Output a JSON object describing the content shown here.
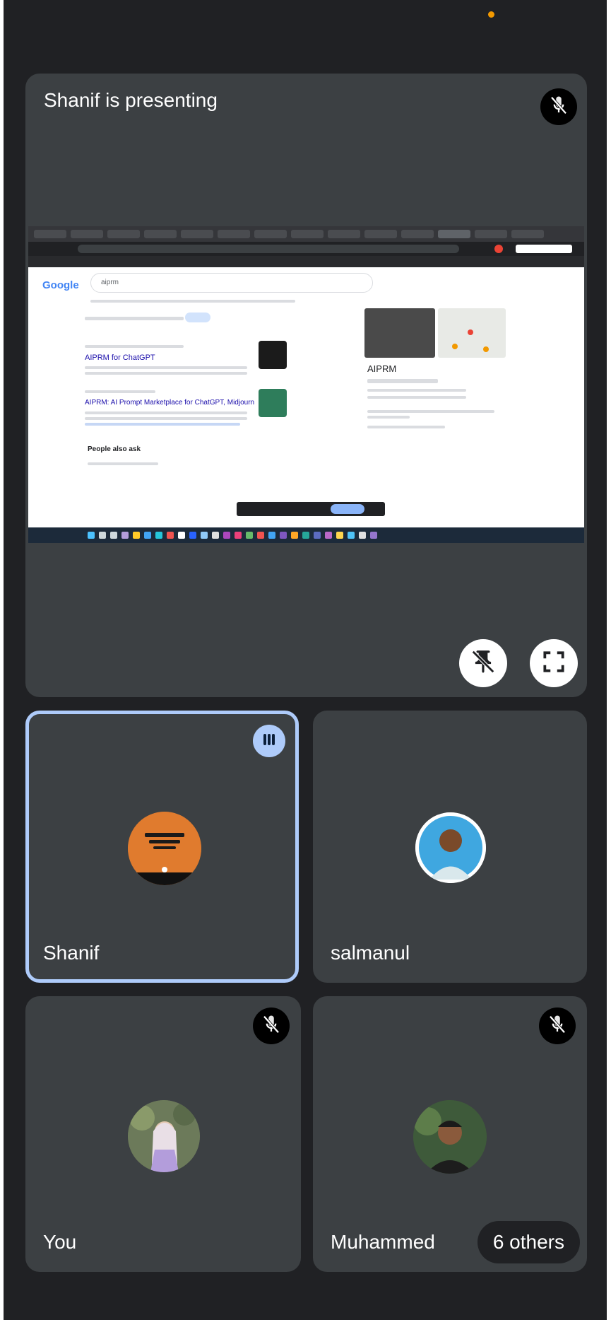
{
  "presentation": {
    "title": "Shanif is presenting",
    "shared_screen": {
      "search_engine": "Google",
      "search_query": "aiprm",
      "result_1_title": "AIPRM for ChatGPT",
      "result_2_title": "AIPRM: AI Prompt Marketplace for ChatGPT, Midjourney ...",
      "panel_title": "AIPRM",
      "section_title": "People also ask"
    }
  },
  "participants": [
    {
      "name": "Shanif",
      "speaking": true
    },
    {
      "name": "salmanul",
      "speaking": false
    },
    {
      "name": "You",
      "muted": true
    },
    {
      "name": "Muhammed",
      "muted": true
    }
  ],
  "others_chip": "6 others",
  "colors": {
    "background": "#202124",
    "tile": "#3c4043",
    "speaking_border": "#aecbfa",
    "status_dot": "#f29900"
  },
  "icons": {
    "mic_off": "mic-off-icon",
    "unpin": "unpin-icon",
    "fullscreen": "fullscreen-icon",
    "speaking": "audio-levels-icon"
  }
}
